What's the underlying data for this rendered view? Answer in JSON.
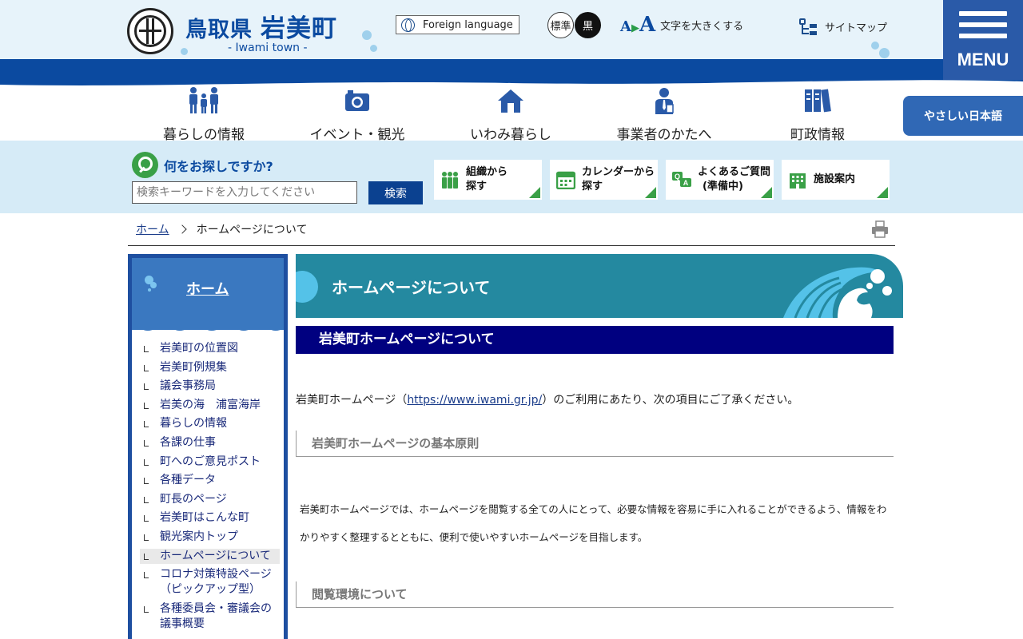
{
  "header": {
    "pref": "鳥取県",
    "town": "岩美町",
    "subtitle": "- Iwami town -",
    "foreign_language": "Foreign language",
    "color_standard": "標準",
    "color_black": "黒",
    "fontsize_icon_text": "A▶A",
    "fontsize_label": "文字を大きくする",
    "sitemap_label": "サイトマップ",
    "menu_label": "MENU"
  },
  "categories": [
    {
      "label": "暮らしの情報",
      "icon": "family-icon"
    },
    {
      "label": "イベント・観光",
      "icon": "camera-icon"
    },
    {
      "label": "いわみ暮らし",
      "icon": "house-icon"
    },
    {
      "label": "事業者のかたへ",
      "icon": "businessperson-icon"
    },
    {
      "label": "町政情報",
      "icon": "binders-icon"
    }
  ],
  "yasashii_label": "やさしい日本語",
  "search": {
    "title": "何をお探しですか?",
    "placeholder": "検索キーワードを入力してください",
    "button": "検索"
  },
  "quick_links": [
    {
      "line1": "組織から",
      "line2": "探す",
      "icon": "people-icon"
    },
    {
      "line1": "カレンダーから",
      "line2": "探す",
      "icon": "calendar-icon"
    },
    {
      "line1": "よくあるご質問",
      "line2": "(準備中)",
      "icon": "qa-icon"
    },
    {
      "line1": "施設案内",
      "line2": "",
      "icon": "building-icon"
    }
  ],
  "breadcrumb": {
    "home": "ホーム",
    "current": "ホームページについて"
  },
  "sidebar": {
    "title": "ホーム",
    "items": [
      "岩美町の位置図",
      "岩美町例規集",
      "議会事務局",
      "岩美の海　浦富海岸",
      "暮らしの情報",
      "各課の仕事",
      "町へのご意見ポスト",
      "各種データ",
      "町長のページ",
      "岩美町はこんな町",
      "観光案内トップ",
      "ホームページについて",
      "コロナ対策特設ページ（ピックアップ型）",
      "各種委員会・審議会の議事概要"
    ],
    "active_index": 11
  },
  "main": {
    "page_title": "ホームページについて",
    "h2": "岩美町ホームページについて",
    "intro_before": "岩美町ホームページ（",
    "intro_link": "https://www.iwami.gr.jp/",
    "intro_after": "）のご利用にあたり、次の項目にご了承ください。",
    "h3_principles": "岩美町ホームページの基本原則",
    "principles_text": "岩美町ホームページでは、ホームページを閲覧する全ての人にとって、必要な情報を容易に手に入れることができるよう、情報をわかりやすく整理するとともに、便利で使いやすいホームページを目指します。",
    "h3_environment": "閲覧環境について"
  },
  "colors": {
    "brand_blue": "#0b4aa0",
    "header_bg": "#e7f3fa",
    "search_bg": "#d6ebf7",
    "banner_teal": "#2489a0",
    "h2_navy": "#000080",
    "accent_green": "#3aa047"
  }
}
